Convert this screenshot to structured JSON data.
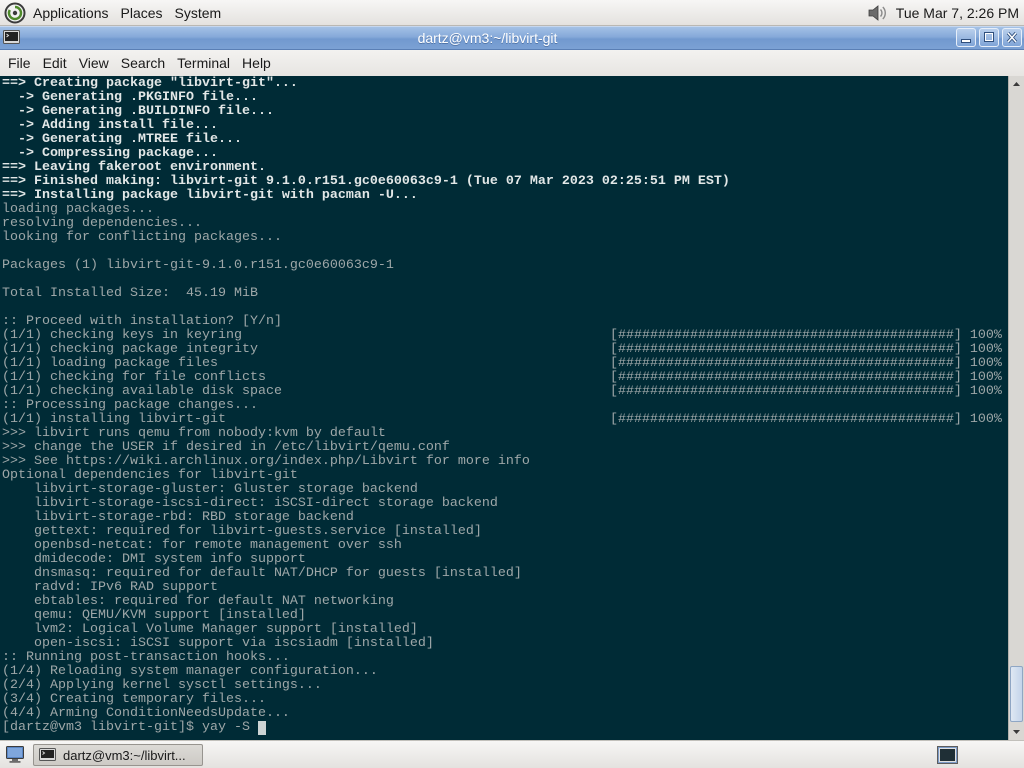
{
  "top_panel": {
    "menus": [
      "Applications",
      "Places",
      "System"
    ],
    "clock": "Tue Mar 7, 2:26 PM",
    "logo_icon": "distro-logo-icon",
    "volume_icon": "volume-icon"
  },
  "window": {
    "title": "dartz@vm3:~/libvirt-git",
    "icon": "terminal-icon",
    "menubar": [
      "File",
      "Edit",
      "View",
      "Search",
      "Terminal",
      "Help"
    ]
  },
  "terminal": {
    "lines": [
      {
        "text": "==> Creating package \"libvirt-git\"...",
        "bold": true
      },
      {
        "text": "  -> Generating .PKGINFO file...",
        "bold": true
      },
      {
        "text": "  -> Generating .BUILDINFO file...",
        "bold": true
      },
      {
        "text": "  -> Adding install file...",
        "bold": true
      },
      {
        "text": "  -> Generating .MTREE file...",
        "bold": true
      },
      {
        "text": "  -> Compressing package...",
        "bold": true
      },
      {
        "text": "==> Leaving fakeroot environment.",
        "bold": true
      },
      {
        "text": "==> Finished making: libvirt-git 9.1.0.r151.gc0e60063c9-1 (Tue 07 Mar 2023 02:25:51 PM EST)",
        "bold": true
      },
      {
        "text": "==> Installing package libvirt-git with pacman -U...",
        "bold": true
      },
      {
        "text": "loading packages..."
      },
      {
        "text": "resolving dependencies..."
      },
      {
        "text": "looking for conflicting packages..."
      },
      {
        "text": ""
      },
      {
        "text": "Packages (1) libvirt-git-9.1.0.r151.gc0e60063c9-1"
      },
      {
        "text": ""
      },
      {
        "text": "Total Installed Size:  45.19 MiB"
      },
      {
        "text": ""
      },
      {
        "text": ":: Proceed with installation? [Y/n]"
      },
      {
        "text": "(1/1) checking keys in keyring",
        "bar": "[##########################################]",
        "percent": "100%"
      },
      {
        "text": "(1/1) checking package integrity",
        "bar": "[##########################################]",
        "percent": "100%"
      },
      {
        "text": "(1/1) loading package files",
        "bar": "[##########################################]",
        "percent": "100%"
      },
      {
        "text": "(1/1) checking for file conflicts",
        "bar": "[##########################################]",
        "percent": "100%"
      },
      {
        "text": "(1/1) checking available disk space",
        "bar": "[##########################################]",
        "percent": "100%"
      },
      {
        "text": ":: Processing package changes..."
      },
      {
        "text": "(1/1) installing libvirt-git",
        "bar": "[##########################################]",
        "percent": "100%"
      },
      {
        "text": ">>> libvirt runs qemu from nobody:kvm by default"
      },
      {
        "text": ">>> change the USER if desired in /etc/libvirt/qemu.conf"
      },
      {
        "text": ">>> See https://wiki.archlinux.org/index.php/Libvirt for more info"
      },
      {
        "text": "Optional dependencies for libvirt-git"
      },
      {
        "text": "    libvirt-storage-gluster: Gluster storage backend"
      },
      {
        "text": "    libvirt-storage-iscsi-direct: iSCSI-direct storage backend"
      },
      {
        "text": "    libvirt-storage-rbd: RBD storage backend"
      },
      {
        "text": "    gettext: required for libvirt-guests.service [installed]"
      },
      {
        "text": "    openbsd-netcat: for remote management over ssh"
      },
      {
        "text": "    dmidecode: DMI system info support"
      },
      {
        "text": "    dnsmasq: required for default NAT/DHCP for guests [installed]"
      },
      {
        "text": "    radvd: IPv6 RAD support"
      },
      {
        "text": "    ebtables: required for default NAT networking"
      },
      {
        "text": "    qemu: QEMU/KVM support [installed]"
      },
      {
        "text": "    lvm2: Logical Volume Manager support [installed]"
      },
      {
        "text": "    open-iscsi: iSCSI support via iscsiadm [installed]"
      },
      {
        "text": ":: Running post-transaction hooks..."
      },
      {
        "text": "(1/4) Reloading system manager configuration..."
      },
      {
        "text": "(2/4) Applying kernel sysctl settings..."
      },
      {
        "text": "(3/4) Creating temporary files..."
      },
      {
        "text": "(4/4) Arming ConditionNeedsUpdate..."
      },
      {
        "text": "[dartz@vm3 libvirt-git]$ yay -S ",
        "cursor": true
      }
    ]
  },
  "bottom_panel": {
    "show_desktop_icon": "show-desktop-icon",
    "task_label": "dartz@vm3:~/libvirt...",
    "task_icon": "terminal-icon"
  },
  "colors": {
    "terminal_bg": "#002b36",
    "terminal_fg": "#9ea7a8",
    "terminal_bold": "#e2e7e7",
    "titlebar": "#7aa0d2",
    "panel": "#edeceb"
  }
}
